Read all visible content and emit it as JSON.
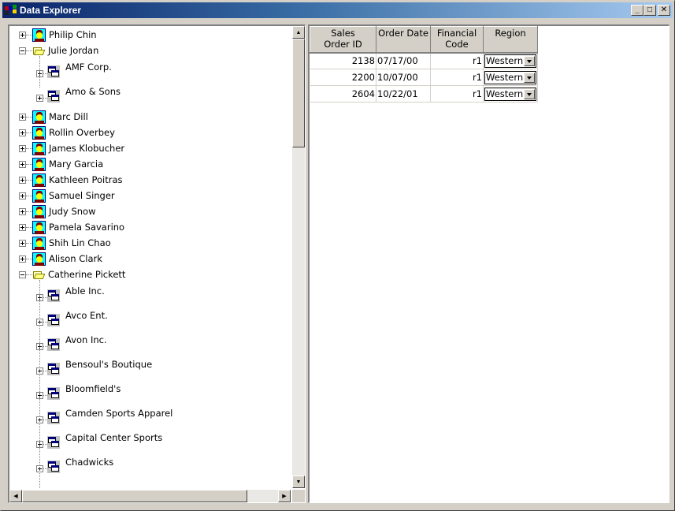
{
  "window": {
    "title": "Data Explorer",
    "controls": {
      "minimize": "_",
      "maximize": "□",
      "close": "✕"
    }
  },
  "tree": {
    "nodes": [
      {
        "label": "Philip  Chin",
        "type": "person",
        "expanded": false
      },
      {
        "label": "Julie  Jordan",
        "type": "person",
        "expanded": true,
        "children": [
          {
            "label": "AMF Corp.",
            "type": "customer"
          },
          {
            "label": "Amo & Sons",
            "type": "customer"
          }
        ]
      },
      {
        "label": "Marc  Dill",
        "type": "person",
        "expanded": false
      },
      {
        "label": "Rollin  Overbey",
        "type": "person",
        "expanded": false
      },
      {
        "label": "James  Klobucher",
        "type": "person",
        "expanded": false
      },
      {
        "label": "Mary  Garcia",
        "type": "person",
        "expanded": false
      },
      {
        "label": "Kathleen  Poitras",
        "type": "person",
        "expanded": false
      },
      {
        "label": "Samuel  Singer",
        "type": "person",
        "expanded": false
      },
      {
        "label": "Judy  Snow",
        "type": "person",
        "expanded": false
      },
      {
        "label": "Pamela  Savarino",
        "type": "person",
        "expanded": false
      },
      {
        "label": "Shih Lin  Chao",
        "type": "person",
        "expanded": false
      },
      {
        "label": "Alison  Clark",
        "type": "person",
        "expanded": false
      },
      {
        "label": "Catherine  Pickett",
        "type": "person",
        "expanded": true,
        "children": [
          {
            "label": "Able Inc.",
            "type": "customer"
          },
          {
            "label": "Avco Ent.",
            "type": "customer"
          },
          {
            "label": "Avon Inc.",
            "type": "customer"
          },
          {
            "label": "Bensoul's Boutique",
            "type": "customer"
          },
          {
            "label": "Bloomfield's",
            "type": "customer"
          },
          {
            "label": "Camden Sports Apparel",
            "type": "customer"
          },
          {
            "label": "Capital Center Sports",
            "type": "customer"
          },
          {
            "label": "Chadwicks",
            "type": "customer"
          }
        ]
      }
    ]
  },
  "grid": {
    "columns": [
      "Sales Order ID",
      "Order Date",
      "Financial Code",
      "Region"
    ],
    "rows": [
      {
        "id": "2138",
        "date": "07/17/00",
        "code": "r1",
        "region": "Western"
      },
      {
        "id": "2200",
        "date": "10/07/00",
        "code": "r1",
        "region": "Western"
      },
      {
        "id": "2604",
        "date": "10/22/01",
        "code": "r1",
        "region": "Western"
      }
    ]
  }
}
